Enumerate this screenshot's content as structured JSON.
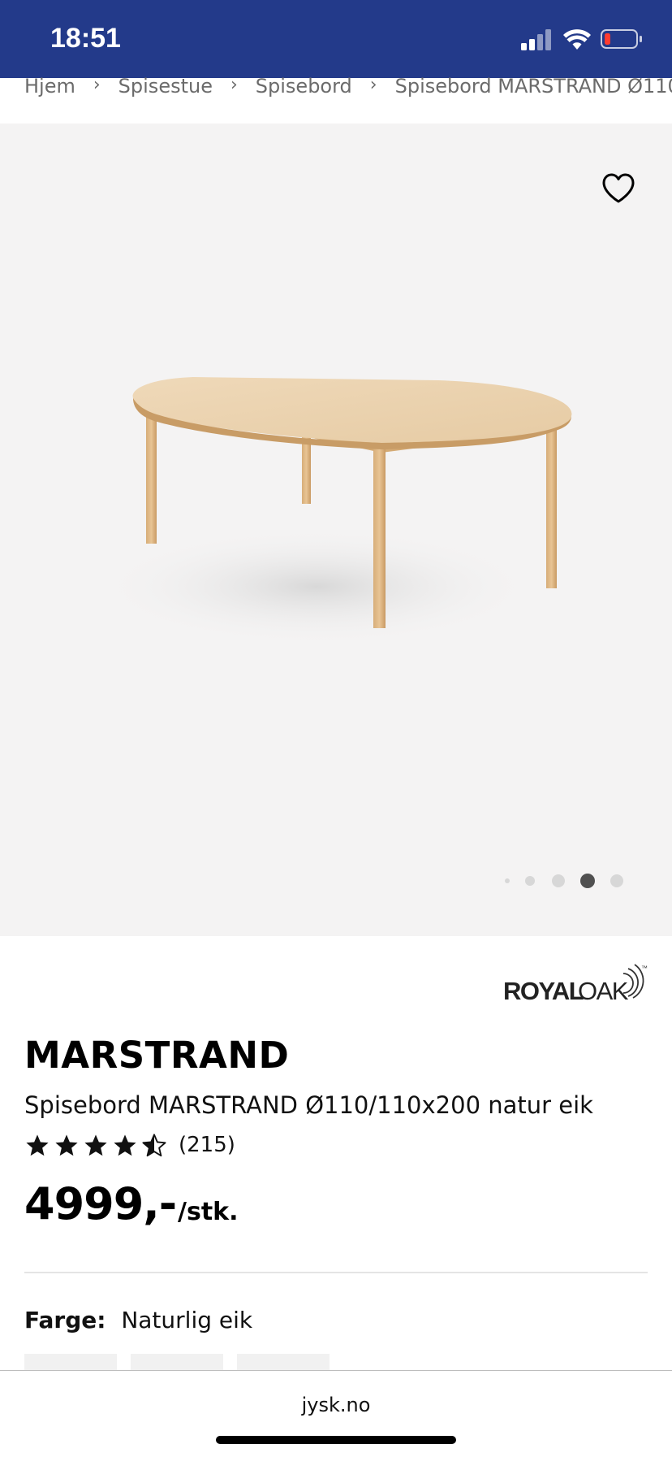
{
  "status_bar": {
    "time": "18:51",
    "bg_color": "#233a8a"
  },
  "breadcrumb": {
    "items": [
      "Hjem",
      "Spisestue",
      "Spisebord",
      "Spisebord MARSTRAND Ø110/1´"
    ],
    "separator": "›"
  },
  "gallery": {
    "favorite_icon": "heart-outline-icon",
    "image_count": 5,
    "active_index": 3
  },
  "brand": {
    "name": "ROYAL OAK",
    "logo_word_1": "ROYAL",
    "logo_word_2": "OAK",
    "trademark": "™"
  },
  "product": {
    "title": "MARSTRAND",
    "subtitle": "Spisebord MARSTRAND Ø110/110x200 natur eik",
    "rating": 4.5,
    "rating_max": 5,
    "review_count": "(215)",
    "price": "4999,-",
    "price_unit": "/stk."
  },
  "color_option": {
    "label": "Farge:",
    "value": "Naturlig eik"
  },
  "browser": {
    "url": "jysk.no"
  }
}
